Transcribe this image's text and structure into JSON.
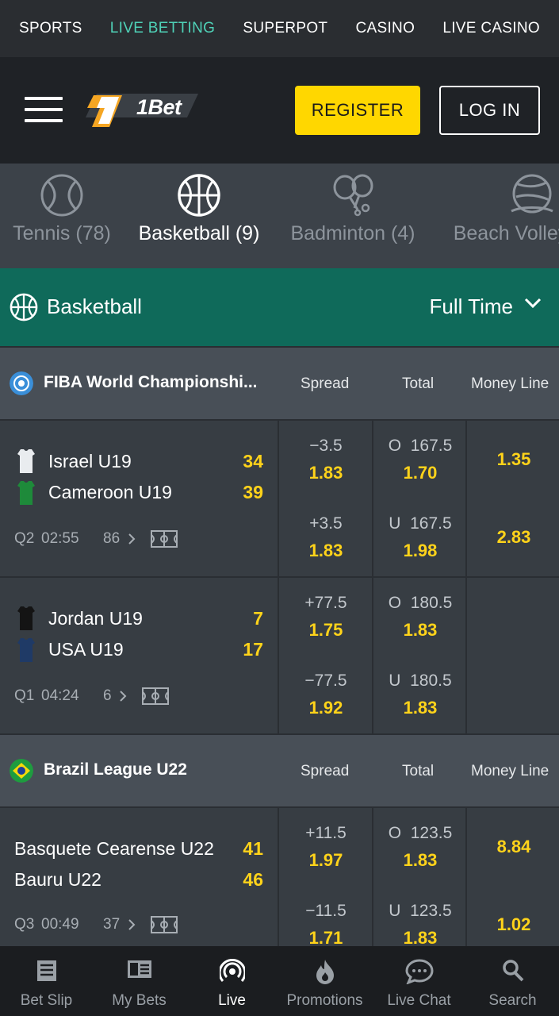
{
  "topnav": {
    "items": [
      "SPORTS",
      "LIVE BETTING",
      "SUPERPOT",
      "CASINO",
      "LIVE CASINO"
    ],
    "active": "LIVE BETTING"
  },
  "header": {
    "logo_text": "1Bet",
    "register_label": "REGISTER",
    "login_label": "LOG IN"
  },
  "sports": [
    {
      "label": "Tennis (78)",
      "icon": "tennis-ball-icon"
    },
    {
      "label": "Basketball (9)",
      "icon": "basketball-icon",
      "active": true
    },
    {
      "label": "Badminton (4)",
      "icon": "badminton-icon"
    },
    {
      "label": "Beach Volley",
      "icon": "beach-volleyball-icon"
    }
  ],
  "sport_bar": {
    "title": "Basketball",
    "period": "Full Time"
  },
  "columns": {
    "spread": "Spread",
    "total": "Total",
    "money_line": "Money Line"
  },
  "leagues": [
    {
      "name": "FIBA World Championshi...",
      "matches": [
        {
          "home": "Israel U19",
          "home_score": "34",
          "away": "Cameroon U19",
          "away_score": "39",
          "period": "Q2",
          "clock": "02:55",
          "markets": "86",
          "spread": [
            {
              "line": "−3.5",
              "odds": "1.83"
            },
            {
              "line": "+3.5",
              "odds": "1.83"
            }
          ],
          "total": [
            {
              "line": "O  167.5",
              "odds": "1.70"
            },
            {
              "line": "U  167.5",
              "odds": "1.98"
            }
          ],
          "money_line": [
            "1.35",
            "2.83"
          ]
        },
        {
          "home": "Jordan U19",
          "home_score": "7",
          "away": "USA U19",
          "away_score": "17",
          "period": "Q1",
          "clock": "04:24",
          "markets": "6",
          "spread": [
            {
              "line": "+77.5",
              "odds": "1.75"
            },
            {
              "line": "−77.5",
              "odds": "1.92"
            }
          ],
          "total": [
            {
              "line": "O  180.5",
              "odds": "1.83"
            },
            {
              "line": "U  180.5",
              "odds": "1.83"
            }
          ],
          "money_line": [
            "",
            ""
          ]
        }
      ]
    },
    {
      "name": "Brazil League U22",
      "matches": [
        {
          "home": "Basquete Cearense U22",
          "home_score": "41",
          "away": "Bauru U22",
          "away_score": "46",
          "period": "Q3",
          "clock": "00:49",
          "markets": "37",
          "spread": [
            {
              "line": "+11.5",
              "odds": "1.97"
            },
            {
              "line": "−11.5",
              "odds": "1.71"
            }
          ],
          "total": [
            {
              "line": "O  123.5",
              "odds": "1.83"
            },
            {
              "line": "U  123.5",
              "odds": "1.83"
            }
          ],
          "money_line": [
            "8.84",
            "1.02"
          ]
        }
      ]
    }
  ],
  "bottomnav": [
    {
      "label": "Bet Slip",
      "icon": "bet-slip-icon"
    },
    {
      "label": "My Bets",
      "icon": "my-bets-icon"
    },
    {
      "label": "Live",
      "icon": "live-icon",
      "active": true
    },
    {
      "label": "Promotions",
      "icon": "flame-icon"
    },
    {
      "label": "Live Chat",
      "icon": "chat-icon"
    },
    {
      "label": "Search",
      "icon": "search-icon"
    }
  ],
  "colors": {
    "accent": "#4fd1b7",
    "brand_yellow": "#ffd700",
    "odds_yellow": "#ffd31a",
    "sport_bar": "#0f6a5a"
  }
}
